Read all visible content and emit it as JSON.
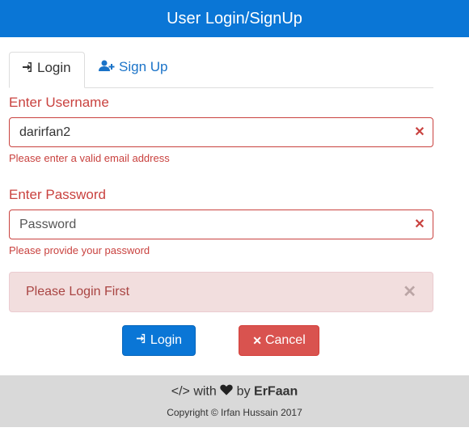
{
  "header": {
    "title": "User Login/SignUp"
  },
  "tabs": [
    {
      "label": "Login",
      "icon": "sign-in-icon"
    },
    {
      "label": "Sign Up",
      "icon": "user-plus-icon"
    }
  ],
  "username": {
    "label": "Enter Username",
    "value": "darirfan2",
    "error": "Please enter a valid email address"
  },
  "password": {
    "label": "Enter Password",
    "placeholder": "Password",
    "error": "Please provide your password"
  },
  "alert": {
    "message": "Please Login First"
  },
  "buttons": {
    "login": "Login",
    "cancel": "Cancel"
  },
  "footer": {
    "code_glyph": "</>",
    "with_text": "with",
    "by_text": "by",
    "author": "ErFaan",
    "copyright": "Copyright © Irfan Hussain 2017"
  },
  "colors": {
    "brand_blue": "#0a76d6",
    "error_red": "#c9423f",
    "alert_bg": "#f2dede",
    "cancel_red": "#d9534f",
    "footer_bg": "#d9d9d9"
  }
}
